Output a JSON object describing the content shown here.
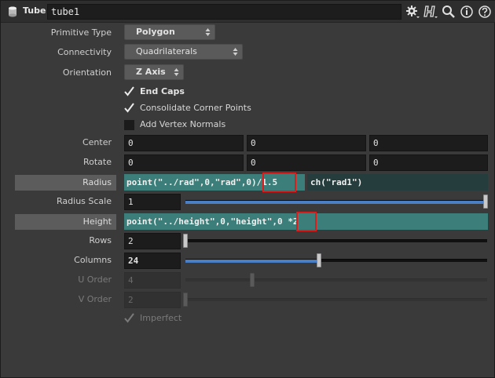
{
  "header": {
    "node_type": "Tube",
    "node_name": "tube1",
    "icons": [
      "gear-icon",
      "houdini-help-icon",
      "search-icon",
      "info-icon",
      "help-icon"
    ]
  },
  "params": {
    "primitive_type": {
      "label": "Primitive Type",
      "value": "Polygon"
    },
    "connectivity": {
      "label": "Connectivity",
      "value": "Quadrilaterals"
    },
    "orientation": {
      "label": "Orientation",
      "value": "Z Axis"
    },
    "end_caps": {
      "label": "End Caps",
      "checked": true
    },
    "consolidate": {
      "label": "Consolidate Corner Points",
      "checked": true
    },
    "vertex_normals": {
      "label": "Add Vertex Normals",
      "checked": false
    },
    "center": {
      "label": "Center",
      "values": [
        "0",
        "0",
        "0"
      ]
    },
    "rotate": {
      "label": "Rotate",
      "values": [
        "0",
        "0",
        "0"
      ]
    },
    "radius": {
      "label": "Radius",
      "expr1_main": "point(\"../rad\",0,\"rad\",0)",
      "expr1_tail": "/1.5",
      "expr2": "ch(\"rad1\")"
    },
    "radius_scale": {
      "label": "Radius Scale",
      "value": "1",
      "slider": 1.0
    },
    "height": {
      "label": "Height",
      "expr_main": "point(\"../height\",0,\"height\",0 ",
      "expr_tail": "*2"
    },
    "rows": {
      "label": "Rows",
      "value": "2",
      "slider": 0.0
    },
    "columns": {
      "label": "Columns",
      "value": "24",
      "slider": 0.45
    },
    "u_order": {
      "label": "U Order",
      "value": "4"
    },
    "v_order": {
      "label": "V Order",
      "value": "2"
    },
    "imperfect": {
      "label": "Imperfect",
      "checked": true
    }
  }
}
